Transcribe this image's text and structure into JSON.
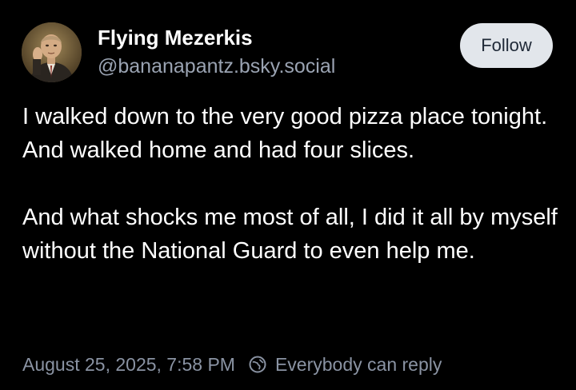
{
  "author": {
    "display_name": "Flying Mezerkis",
    "handle": "@bananapantz.bsky.social",
    "avatar_icon": "portrait-avatar"
  },
  "follow_button": {
    "label": "Follow"
  },
  "post": {
    "paragraphs": [
      "I walked down to the very good pizza place tonight. And walked home and had four slices.",
      "And what shocks me most of all, I did it all by myself without the National Guard to even help me."
    ]
  },
  "meta": {
    "timestamp": "August 25, 2025, 7:58 PM",
    "reply_setting": "Everybody can reply",
    "reply_icon": "globe-icon"
  },
  "colors": {
    "background": "#000000",
    "text": "#ffffff",
    "handle": "#9aa3b2",
    "meta": "#8a93a3",
    "follow_bg": "#e2e6eb",
    "follow_text": "#1f2937"
  }
}
